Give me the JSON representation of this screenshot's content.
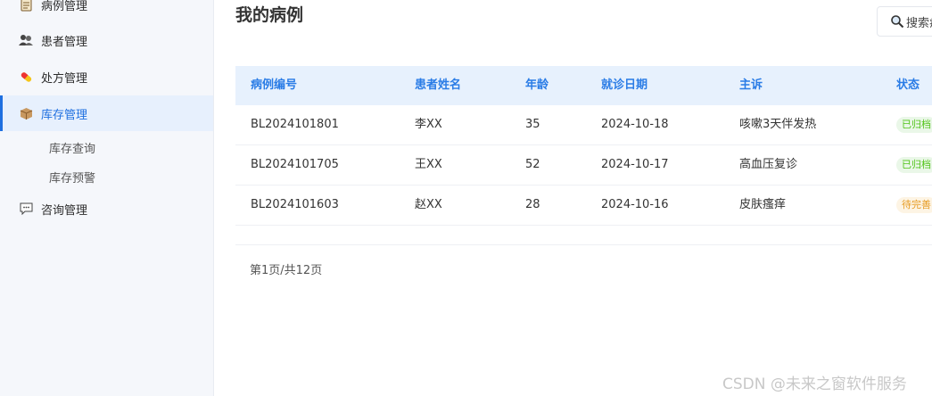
{
  "sidebar": {
    "items": [
      {
        "label": "病例管理",
        "icon": "medical-record-icon"
      },
      {
        "label": "患者管理",
        "icon": "patients-icon"
      },
      {
        "label": "处方管理",
        "icon": "pill-icon"
      },
      {
        "label": "库存管理",
        "icon": "box-icon",
        "active": true
      },
      {
        "label": "咨询管理",
        "icon": "chat-icon"
      }
    ],
    "subitems": [
      "库存查询",
      "库存预警"
    ]
  },
  "main": {
    "title": "我的病例",
    "search_label": "搜索病"
  },
  "table": {
    "headers": [
      "病例编号",
      "患者姓名",
      "年龄",
      "就诊日期",
      "主诉",
      "状态"
    ],
    "rows": [
      {
        "id": "BL2024101801",
        "name": "李XX",
        "age": "35",
        "date": "2024-10-18",
        "complaint": "咳嗽3天伴发热",
        "status": "已归档"
      },
      {
        "id": "BL2024101705",
        "name": "王XX",
        "age": "52",
        "date": "2024-10-17",
        "complaint": "高血压复诊",
        "status": "已归档"
      },
      {
        "id": "BL2024101603",
        "name": "赵XX",
        "age": "28",
        "date": "2024-10-16",
        "complaint": "皮肤瘙痒",
        "status": "待完善"
      }
    ]
  },
  "pagination": {
    "text": "第1页/共12页"
  },
  "watermark": "CSDN @未来之窗软件服务",
  "colors": {
    "accent": "#1e6fe0",
    "header_bg": "#e7f1fd",
    "done": "#52c41a",
    "pending": "#e69b22"
  }
}
